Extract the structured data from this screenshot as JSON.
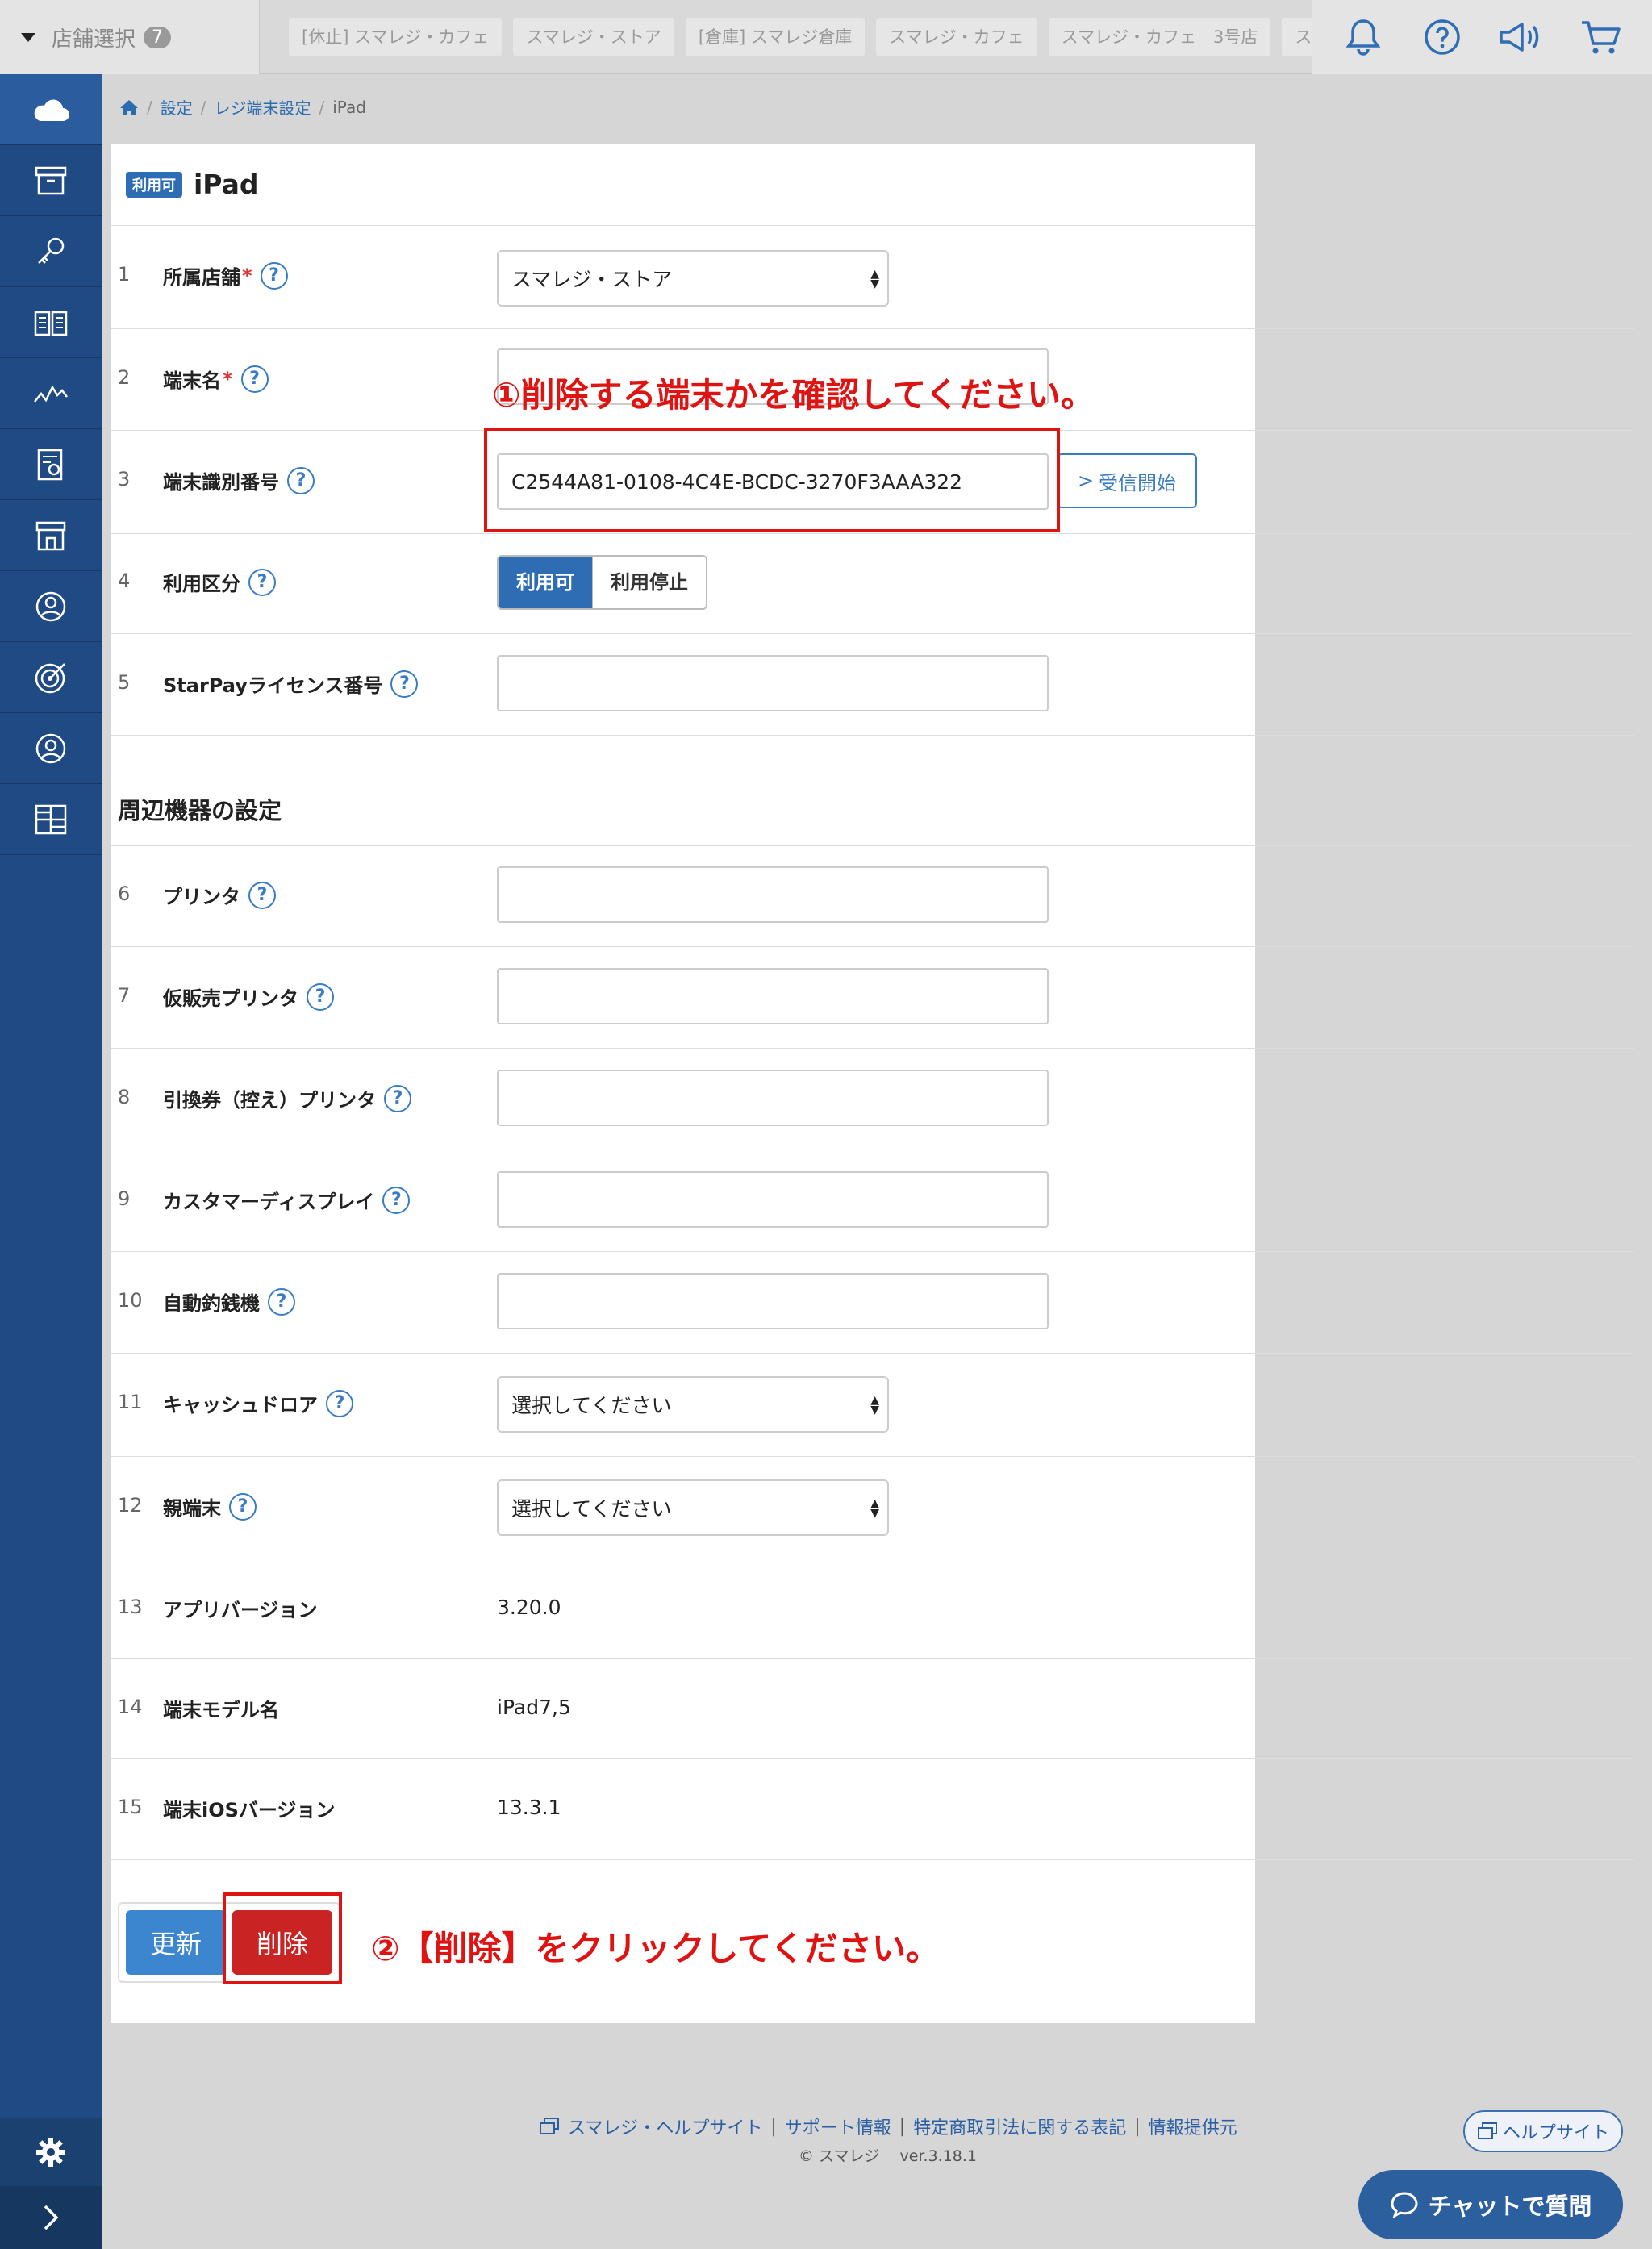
{
  "topbar": {
    "store_select_label": "店舗選択",
    "store_count": "7",
    "store_tabs": [
      "[休止] スマレジ・カフェ",
      "スマレジ・ストア",
      "[倉庫] スマレジ倉庫",
      "スマレジ・カフェ",
      "スマレジ・カフェ　3号店",
      "スマレジ・カ"
    ]
  },
  "breadcrumb": {
    "items": [
      "設定",
      "レジ端末設定",
      "iPad"
    ]
  },
  "panel": {
    "badge": "利用可",
    "title": "iPad",
    "help_mark": "?",
    "required_mark": "*",
    "rows": [
      {
        "num": "1",
        "label": "所属店舗",
        "value": "スマレジ・ストア"
      },
      {
        "num": "2",
        "label": "端末名",
        "value": ""
      },
      {
        "num": "3",
        "label": "端末識別番号",
        "value": "C2544A81-0108-4C4E-BCDC-3270F3AAA322"
      },
      {
        "num": "4",
        "label": "利用区分"
      },
      {
        "num": "5",
        "label": "StarPayライセンス番号",
        "value": ""
      },
      {
        "num": "6",
        "label": "プリンタ",
        "value": ""
      },
      {
        "num": "7",
        "label": "仮販売プリンタ",
        "value": ""
      },
      {
        "num": "8",
        "label": "引換券（控え）プリンタ",
        "value": ""
      },
      {
        "num": "9",
        "label": "カスタマーディスプレイ",
        "value": ""
      },
      {
        "num": "10",
        "label": "自動釣銭機",
        "value": ""
      },
      {
        "num": "11",
        "label": "キャッシュドロア",
        "value": "選択してください"
      },
      {
        "num": "12",
        "label": "親端末",
        "value": "選択してください"
      },
      {
        "num": "13",
        "label": "アプリバージョン",
        "value": "3.20.0"
      },
      {
        "num": "14",
        "label": "端末モデル名",
        "value": "iPad7,5"
      },
      {
        "num": "15",
        "label": "端末iOSバージョン",
        "value": "13.3.1"
      }
    ],
    "receive_button": "受信開始",
    "usage_toggle": {
      "on": "利用可",
      "off": "利用停止"
    },
    "section_peripherals": "周辺機器の設定",
    "update_button": "更新",
    "delete_button": "削除"
  },
  "annotations": {
    "step1": "①削除する端末かを確認してください。",
    "step2": "②【削除】をクリックしてください。"
  },
  "footer": {
    "links": [
      "スマレジ・ヘルプサイト",
      "サポート情報",
      "特定商取引法に関する表記",
      "情報提供元"
    ],
    "copyright": "© スマレジ　 ver.3.18.1",
    "help_site_button": "ヘルプサイト",
    "chat_button": "チャットで質問"
  },
  "colors": {
    "sidebar": "#1f4a84",
    "accent": "#2e6db4",
    "danger": "#c92323",
    "annotation": "#e01313"
  }
}
